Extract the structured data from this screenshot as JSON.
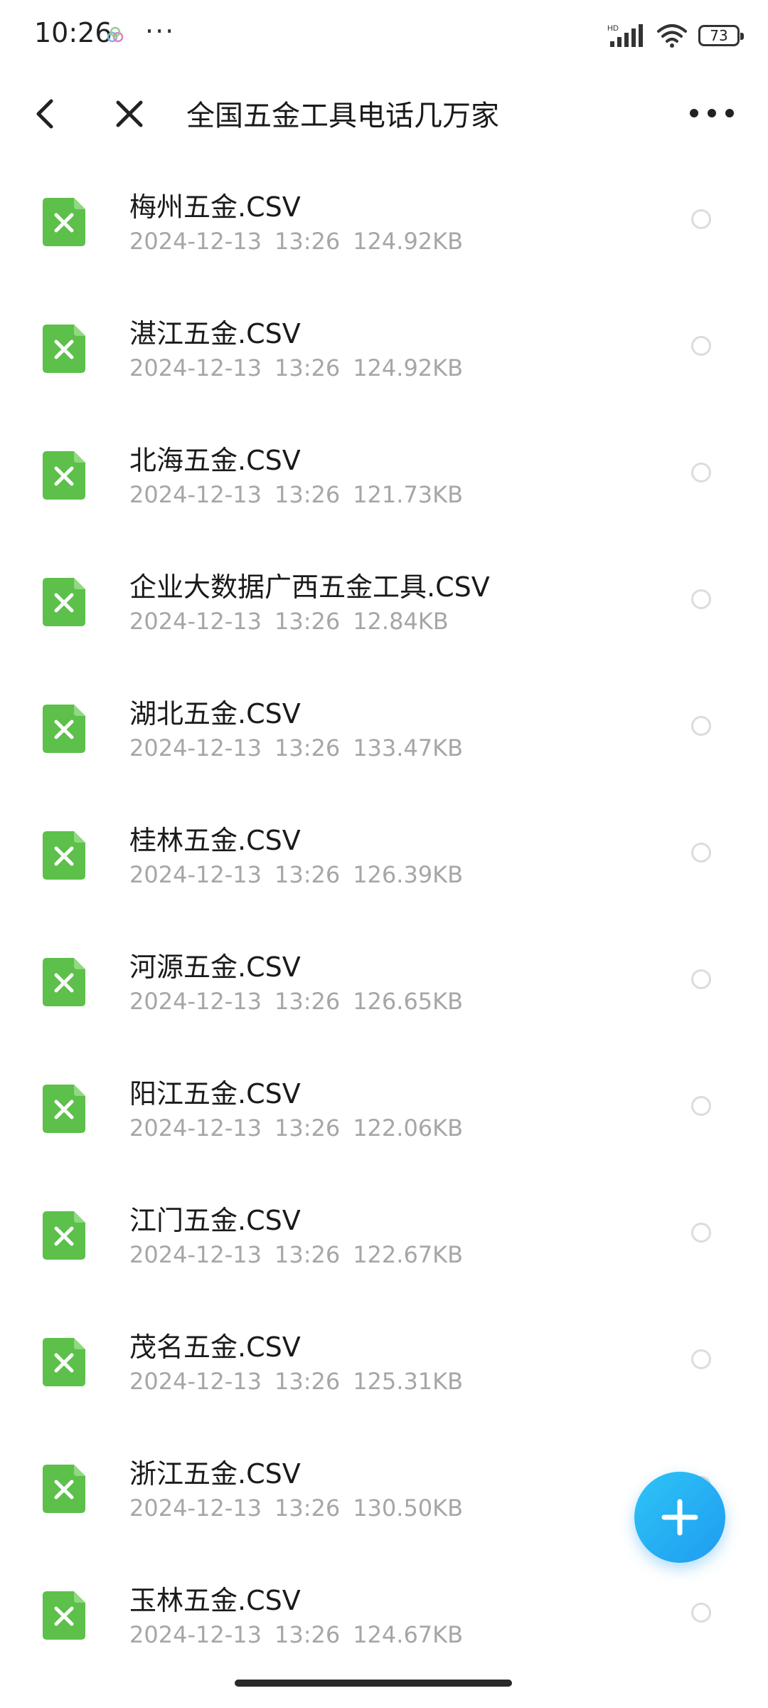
{
  "status_bar": {
    "time": "10:26",
    "dots": "···",
    "battery": "73",
    "network_label": "HD"
  },
  "header": {
    "title": "全国五金工具电话几万家"
  },
  "files": [
    {
      "name": "梅州五金.CSV",
      "date": "2024-12-13",
      "time": "13:26",
      "size": "124.92KB"
    },
    {
      "name": "湛江五金.CSV",
      "date": "2024-12-13",
      "time": "13:26",
      "size": "124.92KB"
    },
    {
      "name": "北海五金.CSV",
      "date": "2024-12-13",
      "time": "13:26",
      "size": "121.73KB"
    },
    {
      "name": "企业大数据广西五金工具.CSV",
      "date": "2024-12-13",
      "time": "13:26",
      "size": "12.84KB"
    },
    {
      "name": "湖北五金.CSV",
      "date": "2024-12-13",
      "time": "13:26",
      "size": "133.47KB"
    },
    {
      "name": "桂林五金.CSV",
      "date": "2024-12-13",
      "time": "13:26",
      "size": "126.39KB"
    },
    {
      "name": "河源五金.CSV",
      "date": "2024-12-13",
      "time": "13:26",
      "size": "126.65KB"
    },
    {
      "name": "阳江五金.CSV",
      "date": "2024-12-13",
      "time": "13:26",
      "size": "122.06KB"
    },
    {
      "name": "江门五金.CSV",
      "date": "2024-12-13",
      "time": "13:26",
      "size": "122.67KB"
    },
    {
      "name": "茂名五金.CSV",
      "date": "2024-12-13",
      "time": "13:26",
      "size": "125.31KB"
    },
    {
      "name": "浙江五金.CSV",
      "date": "2024-12-13",
      "time": "13:26",
      "size": "130.50KB"
    },
    {
      "name": "玉林五金.CSV",
      "date": "2024-12-13",
      "time": "13:26",
      "size": "124.67KB"
    }
  ],
  "icons": {
    "back": "back-arrow-icon",
    "close": "close-icon",
    "more": "more-options-icon",
    "file": "spreadsheet-file-icon",
    "fab": "plus-icon"
  },
  "colors": {
    "file_icon_green": "#5cc04a",
    "fab_blue": "#1e9cf0",
    "meta_gray": "#a6a6a6"
  }
}
